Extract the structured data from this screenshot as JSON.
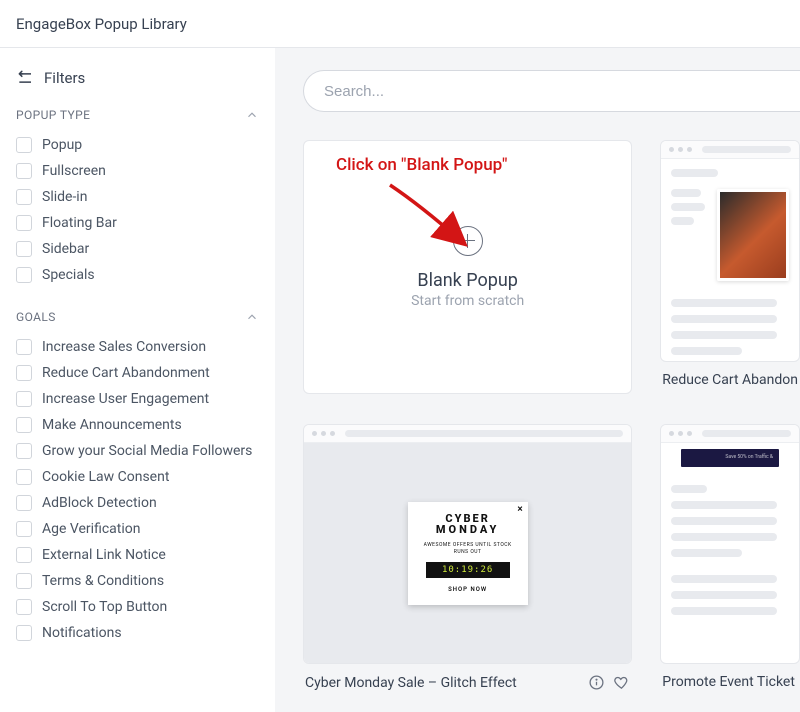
{
  "header": {
    "title": "EngageBox Popup Library"
  },
  "sidebar": {
    "filters_label": "Filters",
    "sections": {
      "popup_type": {
        "title": "POPUP TYPE",
        "items": [
          "Popup",
          "Fullscreen",
          "Slide-in",
          "Floating Bar",
          "Sidebar",
          "Specials"
        ]
      },
      "goals": {
        "title": "GOALS",
        "items": [
          "Increase Sales Conversion",
          "Reduce Cart Abandonment",
          "Increase User Engagement",
          "Make Announcements",
          "Grow your Social Media Followers",
          "Cookie Law Consent",
          "AdBlock Detection",
          "Age Verification",
          "External Link Notice",
          "Terms & Conditions",
          "Scroll To Top Button",
          "Notifications"
        ]
      }
    }
  },
  "search": {
    "placeholder": "Search..."
  },
  "cards": {
    "blank": {
      "title": "Blank Popup",
      "subtitle": "Start from scratch"
    },
    "reduce": {
      "caption": "Reduce Cart Abandon"
    },
    "cyber": {
      "caption": "Cyber Monday Sale – Glitch Effect",
      "modal": {
        "line1": "CYBER",
        "line2": "MONDAY",
        "sub": "AWESOME OFFERS UNTIL STOCK RUNS OUT",
        "timer": "10:19:26",
        "cta": "SHOP NOW"
      }
    },
    "promo": {
      "caption": "Promote Event Ticket"
    }
  },
  "annotation": {
    "text": "Click on \"Blank Popup\""
  }
}
